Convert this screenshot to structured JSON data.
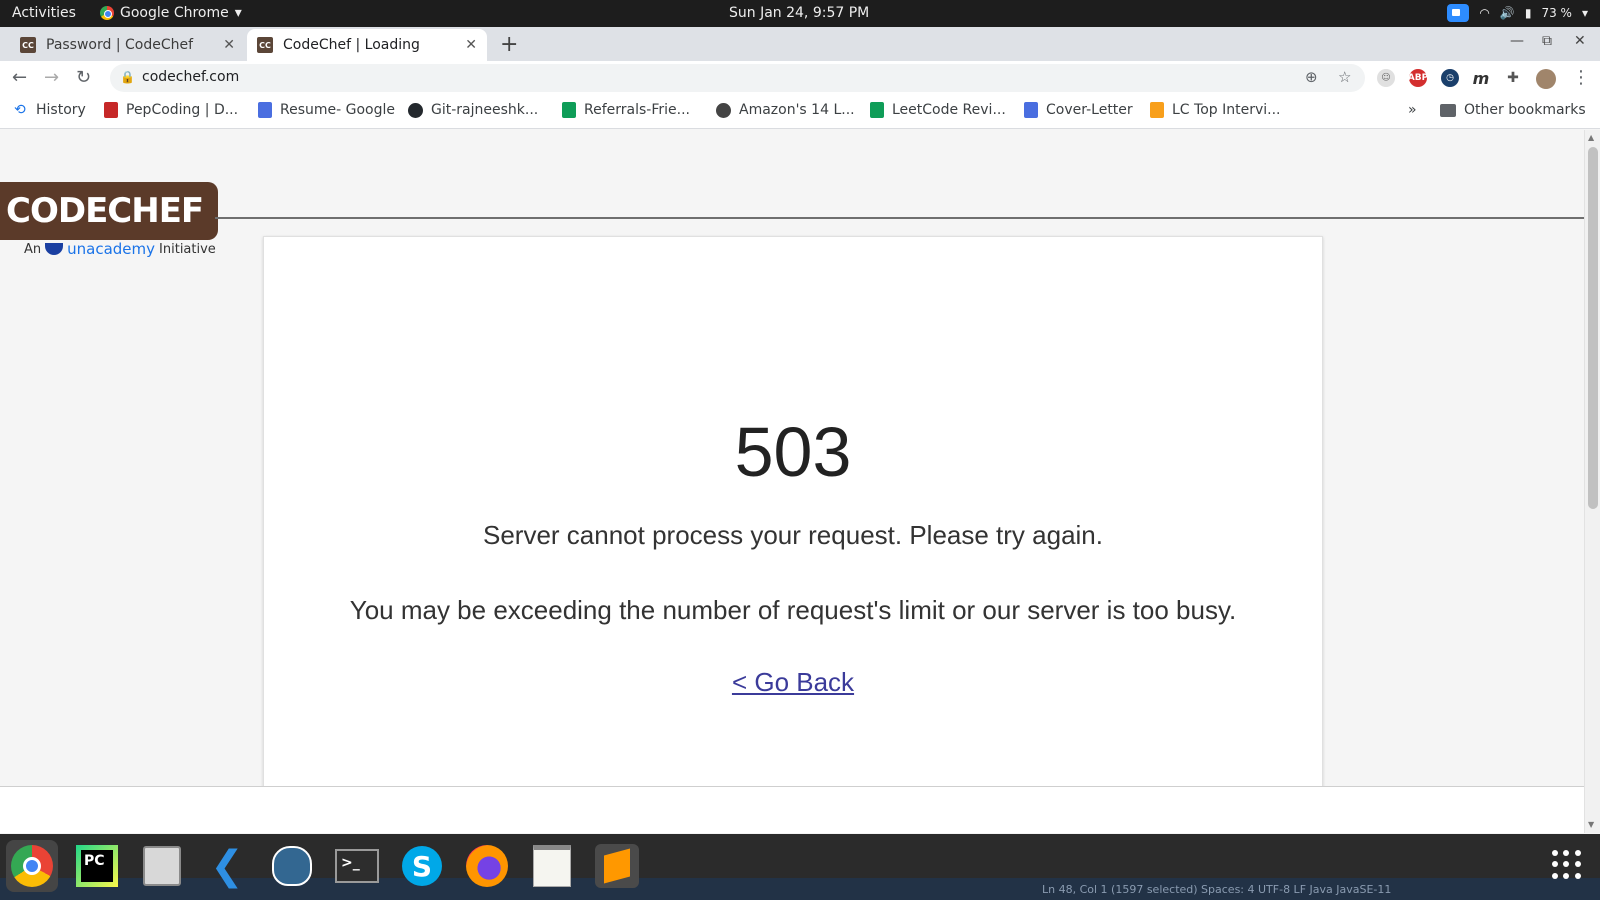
{
  "topbar": {
    "activities": "Activities",
    "app_name": "Google Chrome",
    "clock": "Sun Jan 24,  9:57 PM",
    "battery": "73 %"
  },
  "tabs": [
    {
      "favicon": "CC",
      "title": "Password | CodeChef",
      "close": "✕"
    },
    {
      "favicon": "CC",
      "title": "CodeChef | Loading",
      "close": "✕"
    }
  ],
  "new_tab": "+",
  "window_controls": {
    "minimize": "—",
    "maximize": "⧉",
    "close": "✕"
  },
  "toolbar": {
    "url": "codechef.com",
    "extensions": [
      "ABP"
    ],
    "ext_m": "m"
  },
  "bookmarks": [
    {
      "label": "History",
      "icon_color": "#1a73e8"
    },
    {
      "label": "PepCoding | D...",
      "icon_color": "#c62828"
    },
    {
      "label": "Resume- Google",
      "icon_color": "#4a6ee0"
    },
    {
      "label": "Git-rajneeshk...",
      "icon_color": "#24292e"
    },
    {
      "label": "Referrals-Frie...",
      "icon_color": "#0f9d58"
    },
    {
      "label": "Amazon's 14 L...",
      "icon_color": "#444444"
    },
    {
      "label": "LeetCode Revi...",
      "icon_color": "#0f9d58"
    },
    {
      "label": "Cover-Letter",
      "icon_color": "#4a6ee0"
    },
    {
      "label": "LC Top Intervi...",
      "icon_color": "#f89f1b"
    }
  ],
  "bookmarks_overflow": "»",
  "other_bookmarks": "Other bookmarks",
  "logo": {
    "text": "CODECHEF",
    "tagline_prefix": "An",
    "tagline_brand": "unacademy",
    "tagline_suffix": "Initiative"
  },
  "error": {
    "code": "503",
    "message": "Server cannot process your request. Please try again.",
    "detail": "You may be exceeding the number of request's limit or our server is too busy.",
    "back_link": "< Go Back"
  },
  "dock": {
    "apps": [
      "chrome",
      "pycharm",
      "files",
      "vscode",
      "postgres",
      "terminal",
      "skype",
      "firefox",
      "text-editor",
      "sublime"
    ],
    "pycharm_label": "PC",
    "skype_label": "S",
    "status_bar": "Ln 48, Col 1 (1597 selected)    Spaces: 4    UTF-8    LF    Java    JavaSE-11"
  },
  "colors": {
    "brand_brown": "#5b3a29",
    "link": "#3b3b9a",
    "dock_bg": "#2b2b2b"
  }
}
